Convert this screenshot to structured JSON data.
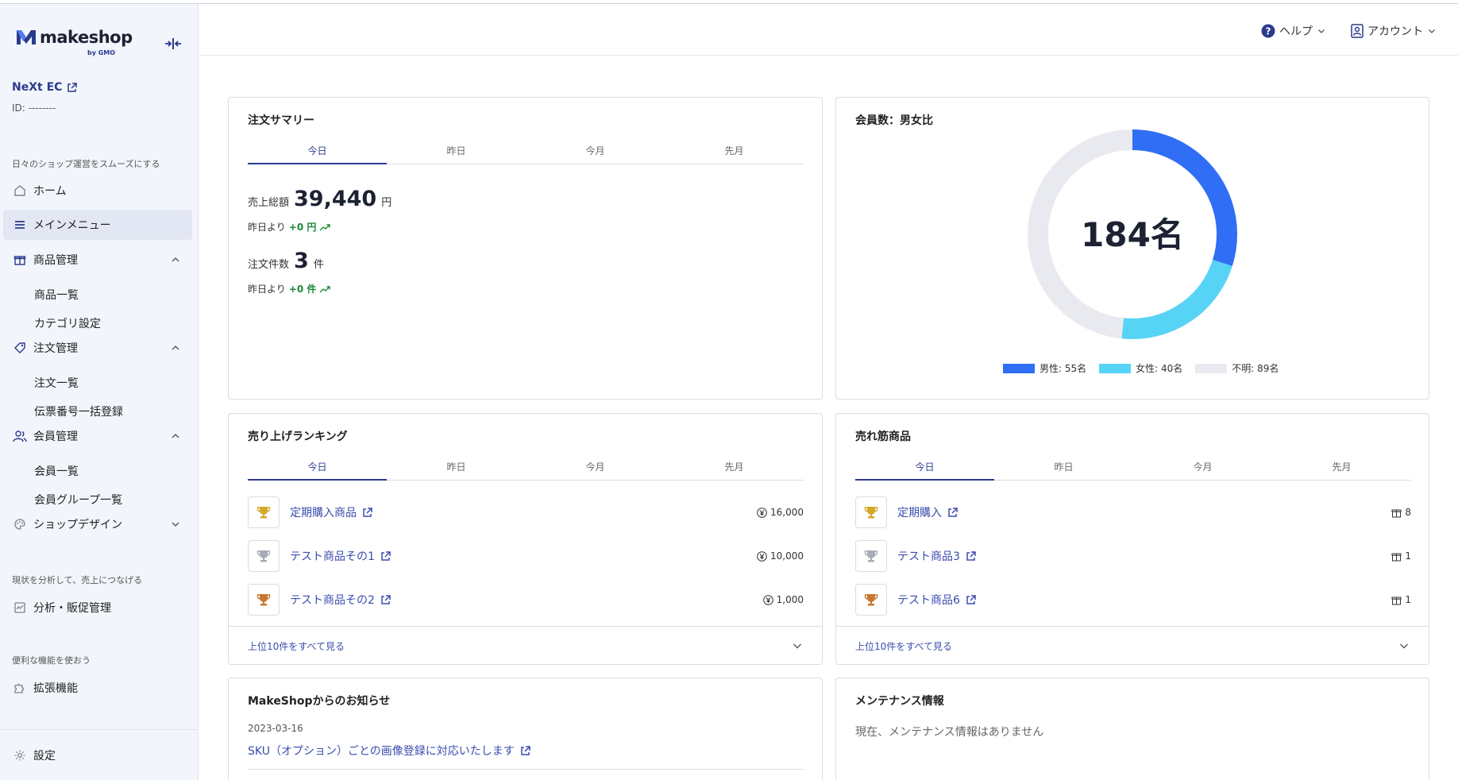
{
  "sidebar": {
    "logo_text": "makeshop",
    "logo_gmo": "by GMO",
    "shop_name": "NeXt EC",
    "shop_id": "ID: --------",
    "section1": "日々のショップ運営をスムーズにする",
    "home": "ホーム",
    "main_menu": "メインメニュー",
    "products": "商品管理",
    "product_list": "商品一覧",
    "category": "カテゴリ設定",
    "orders": "注文管理",
    "order_list": "注文一覧",
    "slip_bulk": "伝票番号一括登録",
    "members": "会員管理",
    "member_list": "会員一覧",
    "member_group": "会員グループ一覧",
    "shop_design": "ショップデザイン",
    "section2": "現状を分析して、売上につなげる",
    "analytics": "分析・販促管理",
    "section3": "便利な機能を使おう",
    "extensions": "拡張機能",
    "settings": "設定"
  },
  "header": {
    "help": "ヘルプ",
    "account": "アカウント"
  },
  "tabs": [
    "今日",
    "昨日",
    "今月",
    "先月"
  ],
  "order_summary": {
    "title": "注文サマリー",
    "sales_label": "売上総額",
    "sales_value": "39,440",
    "sales_unit": "円",
    "sales_delta_prefix": "昨日より",
    "sales_delta": "+0 円",
    "count_label": "注文件数",
    "count_value": "3",
    "count_unit": "件",
    "count_delta_prefix": "昨日より",
    "count_delta": "+0 件"
  },
  "members_chart": {
    "title": "会員数：男女比",
    "center": "184名",
    "legend": [
      {
        "label": "男性: 55名",
        "color": "#2f6ef5"
      },
      {
        "label": "女性: 40名",
        "color": "#57d3f5"
      },
      {
        "label": "不明: 89名",
        "color": "#e9eaef"
      }
    ]
  },
  "chart_data": {
    "type": "pie",
    "categories": [
      "男性",
      "女性",
      "不明"
    ],
    "values": [
      55,
      40,
      89
    ],
    "colors": [
      "#2f6ef5",
      "#57d3f5",
      "#e9eaef"
    ],
    "title": "会員数：男女比",
    "center_label": "184名"
  },
  "ranking": {
    "title": "売り上げランキング",
    "items": [
      {
        "name": "定期購入商品",
        "value": "16,000"
      },
      {
        "name": "テスト商品その1",
        "value": "10,000"
      },
      {
        "name": "テスト商品その2",
        "value": "1,000"
      }
    ],
    "footer": "上位10件をすべて見る"
  },
  "best_sellers": {
    "title": "売れ筋商品",
    "items": [
      {
        "name": "定期購入",
        "value": "8"
      },
      {
        "name": "テスト商品3",
        "value": "1"
      },
      {
        "name": "テスト商品6",
        "value": "1"
      }
    ],
    "footer": "上位10件をすべて見る"
  },
  "news": {
    "title": "MakeShopからのお知らせ",
    "date": "2023-03-16",
    "headline": "SKU（オプション）ごとの画像登録に対応いたします"
  },
  "maintenance": {
    "title": "メンテナンス情報",
    "text": "現在、メンテナンス情報はありません"
  },
  "colors": {
    "primary": "#2b3a8c",
    "link": "#3a4cae",
    "positive": "#1b8a3a",
    "gold": "#d4a82a",
    "silver": "#a7acb5",
    "bronze": "#c7782e"
  }
}
